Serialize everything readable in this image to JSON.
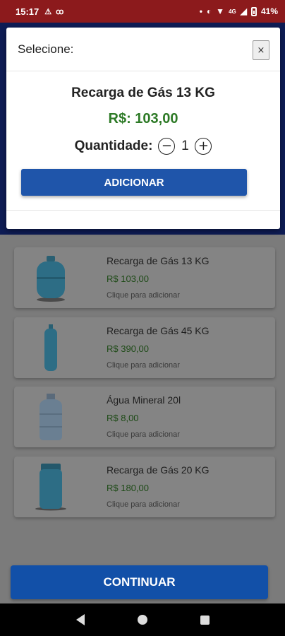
{
  "status_bar": {
    "time": "15:17",
    "left_icons": [
      "warning-icon",
      "voicemail-icon"
    ],
    "network": "4G",
    "battery": "41%"
  },
  "modal": {
    "title": "Selecione:",
    "close_label": "×",
    "product_name": "Recarga de Gás 13 KG",
    "price": "R$: 103,00",
    "quantity_label": "Quantidade:",
    "quantity_value": "1",
    "minus_label": "−",
    "plus_label": "+",
    "add_button": "ADICIONAR"
  },
  "products": [
    {
      "name": "Recarga de Gás 13 KG",
      "price": "R$ 103,00",
      "hint": "Clique para adicionar",
      "icon": "gas-cylinder-icon"
    },
    {
      "name": "Recarga de Gás 45 KG",
      "price": "R$ 390,00",
      "hint": "Clique para adicionar",
      "icon": "tall-gas-cylinder-icon"
    },
    {
      "name": "Água Mineral 20l",
      "price": "R$ 8,00",
      "hint": "Clique para adicionar",
      "icon": "water-jug-icon"
    },
    {
      "name": "Recarga de Gás 20 KG",
      "price": "R$ 180,00",
      "hint": "Clique para adicionar",
      "icon": "gas-cylinder-20-icon"
    }
  ],
  "continue_button": "CONTINUAR",
  "colors": {
    "status_bar": "#8c1a1c",
    "primary_button": "#1f55aa",
    "price_green": "#2d7a26"
  }
}
